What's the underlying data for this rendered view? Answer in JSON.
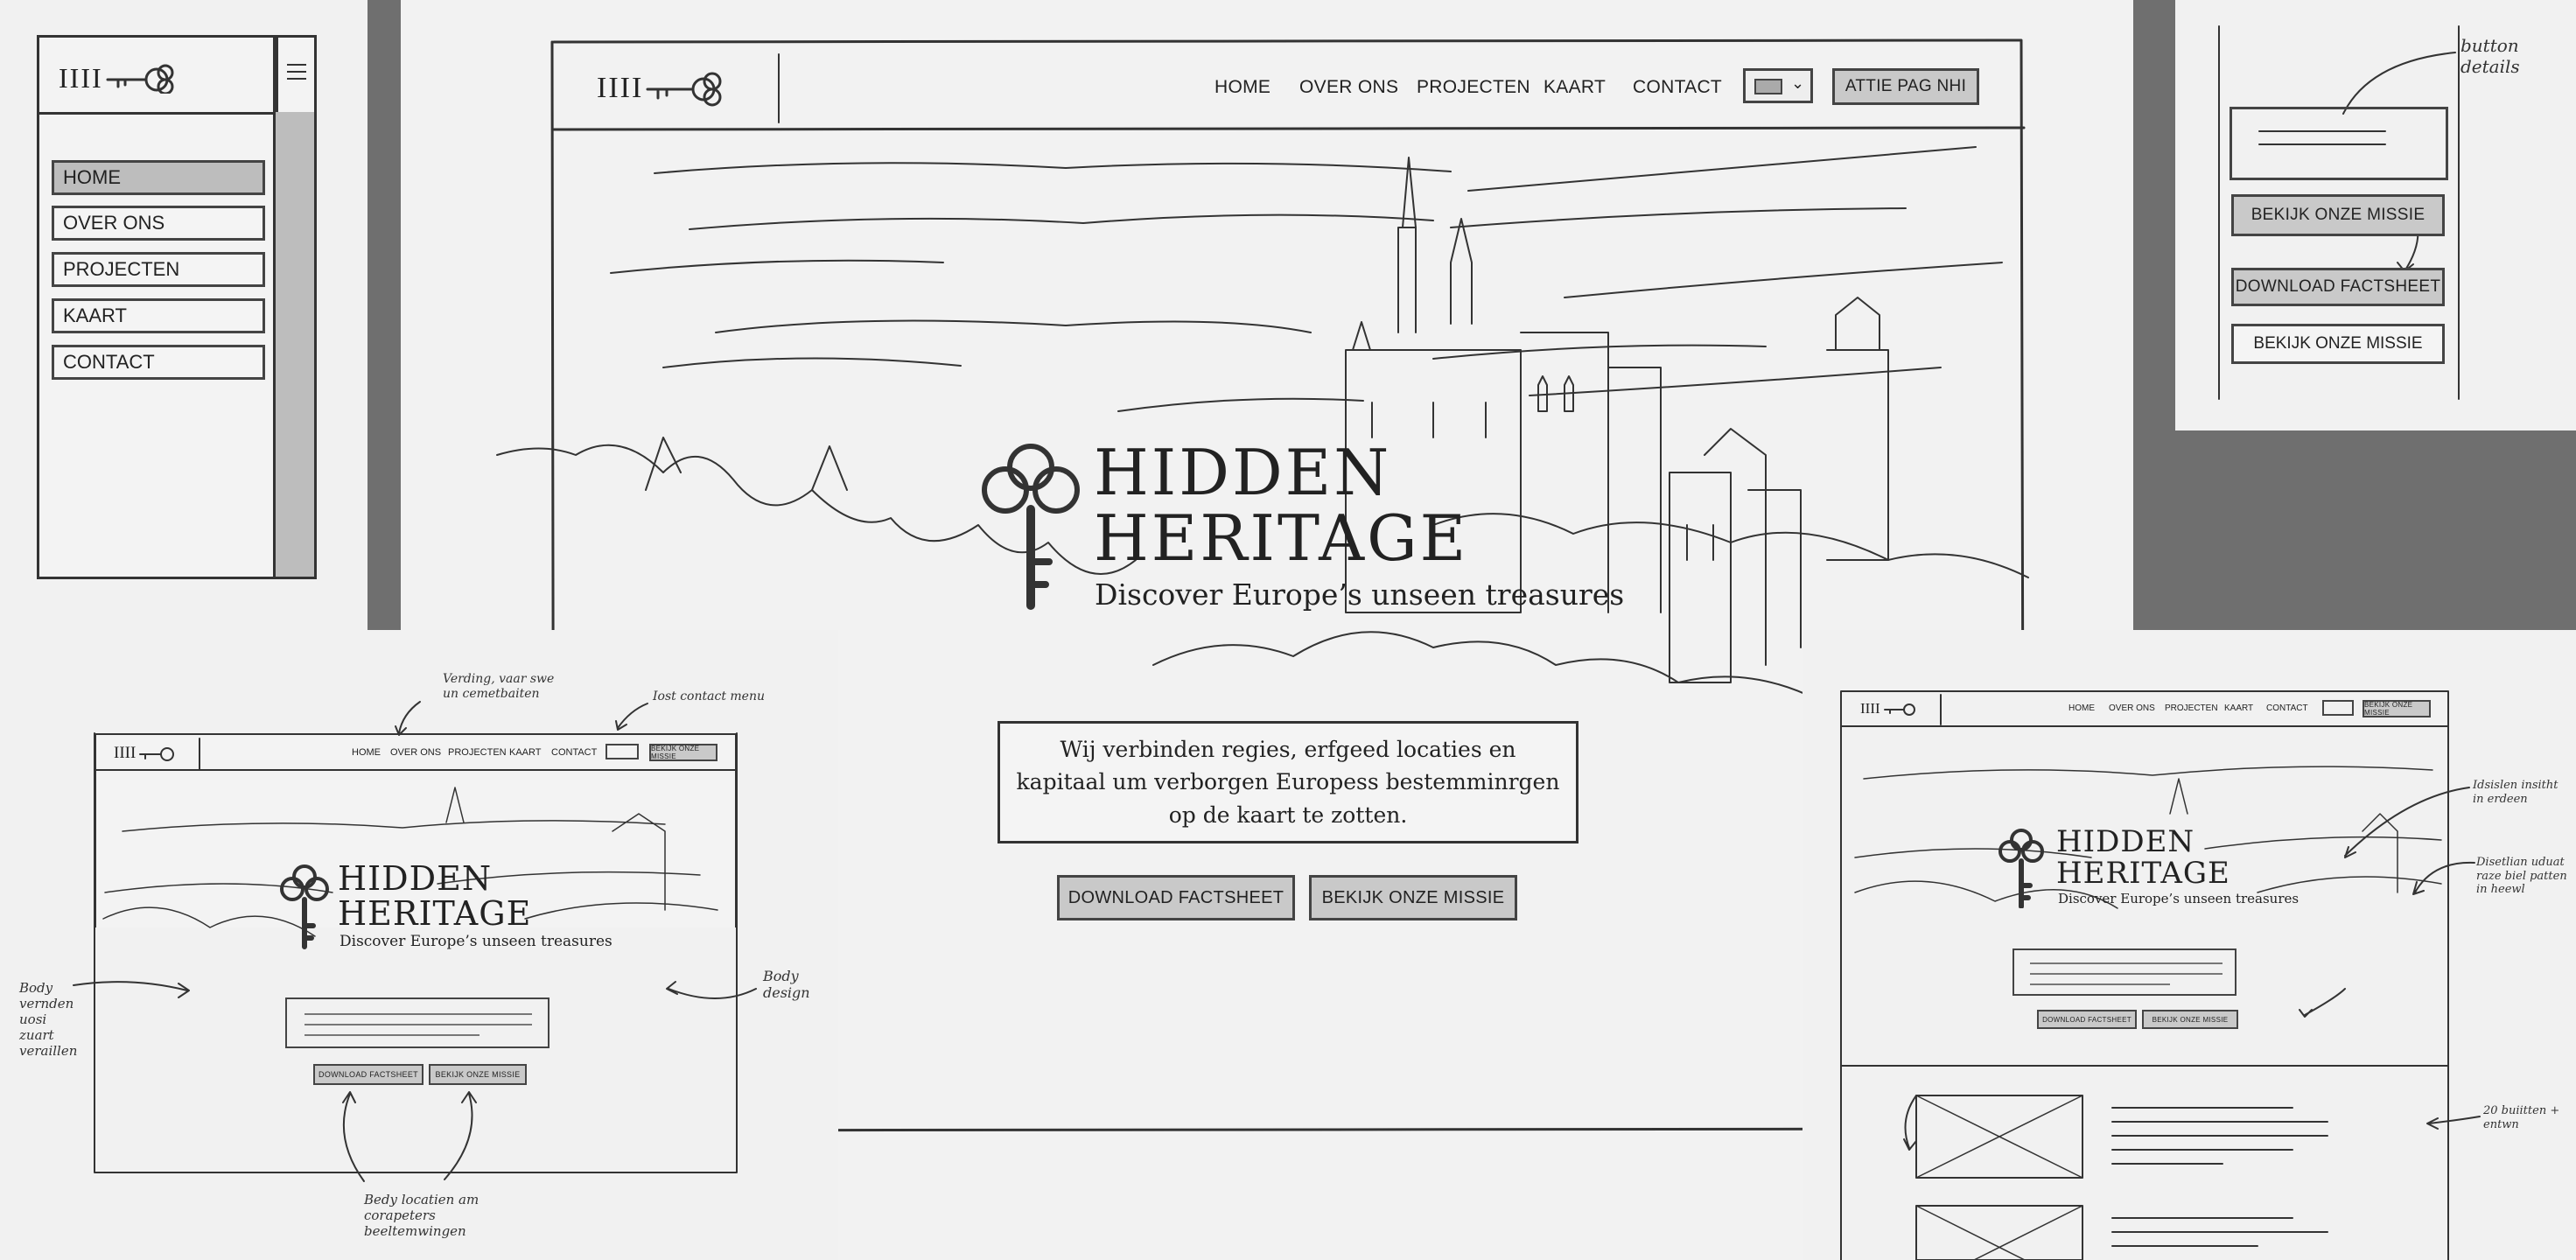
{
  "logo_text": "IIII",
  "top_left": {
    "menu": [
      "HOME",
      "OVER ONS",
      "PROJECTEN",
      "KAART",
      "CONTACT"
    ]
  },
  "main": {
    "nav": [
      "HOME",
      "OVER ONS",
      "PROJECTEN",
      "KAART",
      "CONTACT"
    ],
    "cta": "ATTIE PAG NHI",
    "title_line1": "HIDDEN",
    "title_line2": "HERITAGE",
    "subtitle": "Discover Europe’s unseen treasures",
    "intro": "Wij verbinden regies, erfgeed locaties en kapitaal um verborgen Europess bestemminrgen op de kaart te zotten.",
    "btn_download": "DOWNLOAD FACTSHEET",
    "btn_mission": "BEKIJK ONZE MISSIE"
  },
  "top_right": {
    "note": "button details",
    "buttons": [
      "BEKIJK ONZE MISSIE",
      "DOWNLOAD FACTSHEET",
      "BEKIJK ONZE MISSIE"
    ]
  },
  "bottom_left": {
    "nav": [
      "HOME",
      "OVER ONS",
      "PROJECTEN",
      "KAART",
      "CONTACT"
    ],
    "cta": "BEKIJK ONZE MISSIE",
    "title_line1": "HIDDEN",
    "title_line2": "HERITAGE",
    "subtitle": "Discover Europe’s unseen treasures",
    "btn_download": "DOWNLOAD FACTSHEET",
    "btn_mission": "BEKIJK ONZE MISSIE",
    "note_top": "Verding, vaar swe un cemetbaiten",
    "note_contact": "Iost contact menu",
    "note_left": "Body vernden uosi zuart veraillen",
    "note_right": "Body design",
    "note_bottom": "Bedy locatien am corapeters beeltemwingen"
  },
  "bottom_right": {
    "nav": [
      "HOME",
      "OVER ONS",
      "PROJECTEN",
      "KAART",
      "CONTACT"
    ],
    "cta": "BEKIJK ONZE MISSIE",
    "title_line1": "HIDDEN",
    "title_line2": "HERITAGE",
    "subtitle": "Discover Europe’s unseen treasures",
    "btn_download": "DOWNLOAD FACTSHEET",
    "btn_mission": "BEKIJK ONZE MISSIE",
    "note_1": "Idsislen insitht in erdeen",
    "note_2": "Disetlian uduat raze biel patten in heewl",
    "note_3": "20 buiitten + entwn"
  }
}
